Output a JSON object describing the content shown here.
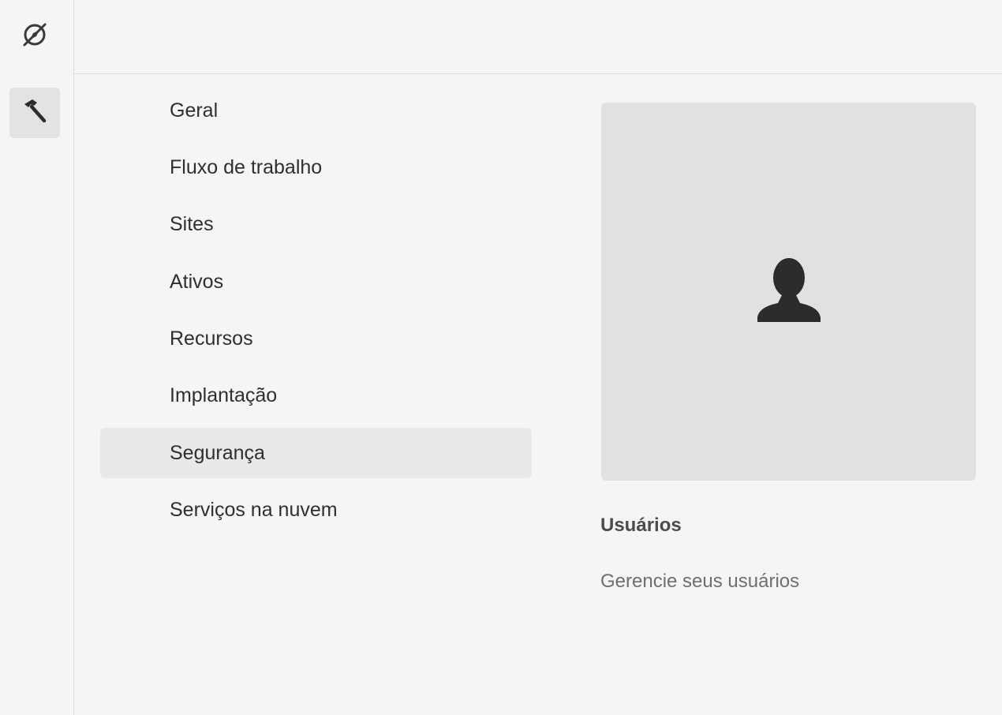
{
  "rail": {
    "items": [
      {
        "icon": "compass-off-icon",
        "active": false
      },
      {
        "icon": "hammer-icon",
        "active": true
      }
    ]
  },
  "menu": {
    "items": [
      {
        "label": "Geral"
      },
      {
        "label": "Fluxo de trabalho"
      },
      {
        "label": "Sites"
      },
      {
        "label": "Ativos"
      },
      {
        "label": "Recursos"
      },
      {
        "label": "Implantação"
      },
      {
        "label": "Segurança",
        "active": true
      },
      {
        "label": "Serviços na nuvem"
      }
    ]
  },
  "card": {
    "icon": "user-icon",
    "title": "Usuários",
    "description": "Gerencie seus usuários"
  },
  "colors": {
    "background": "#f5f5f5",
    "active_item": "#e9e9e9",
    "thumb_bg": "#e1e1e1",
    "icon": "#2c2c2c"
  }
}
